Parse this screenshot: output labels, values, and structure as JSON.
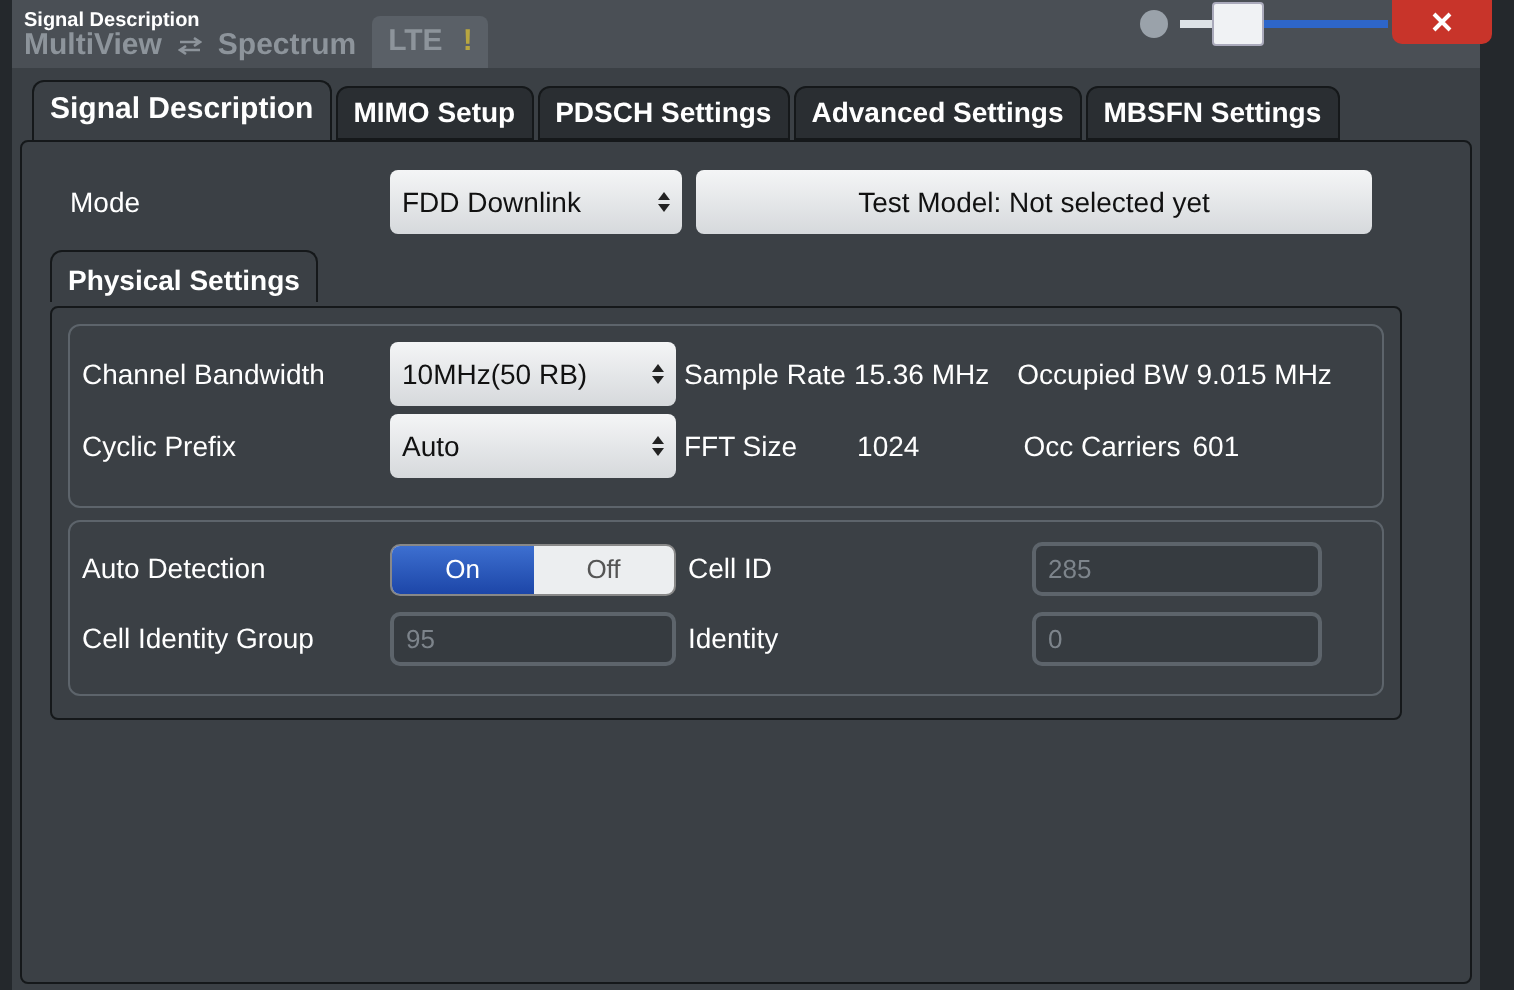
{
  "window": {
    "title": "Signal Description",
    "background_tabs": [
      {
        "label": "MultiView",
        "selected": false
      },
      {
        "label": "Spectrum",
        "selected": false
      },
      {
        "label": "LTE",
        "selected": true,
        "warning": "!"
      }
    ],
    "transparency": {
      "level": 0.2
    }
  },
  "tabs": [
    {
      "label": "Signal Description",
      "selected": true
    },
    {
      "label": "MIMO Setup",
      "selected": false
    },
    {
      "label": "PDSCH Settings",
      "selected": false
    },
    {
      "label": "Advanced Settings",
      "selected": false
    },
    {
      "label": "MBSFN Settings",
      "selected": false
    }
  ],
  "mode": {
    "label": "Mode",
    "value": "FDD Downlink",
    "test_model_button": "Test Model: Not selected yet"
  },
  "physical_settings": {
    "title": "Physical Settings",
    "channel_bandwidth": {
      "label": "Channel Bandwidth",
      "value": "10MHz(50 RB)"
    },
    "sample_rate": {
      "label": "Sample Rate",
      "value": "15.36 MHz"
    },
    "occupied_bw": {
      "label": "Occupied BW",
      "value": "9.015 MHz"
    },
    "cyclic_prefix": {
      "label": "Cyclic Prefix",
      "value": "Auto"
    },
    "fft_size": {
      "label": "FFT Size",
      "value": "1024"
    },
    "occ_carriers": {
      "label": "Occ Carriers",
      "value": "601"
    }
  },
  "detection": {
    "label": "Auto Detection",
    "options": [
      {
        "label": "On",
        "selected": true
      },
      {
        "label": "Off",
        "selected": false
      }
    ],
    "fields": [
      {
        "label": "Cell ID",
        "value": "285",
        "disabled": true
      },
      {
        "label": "Cell Identity Group",
        "value": "95",
        "disabled": true
      },
      {
        "label": "Identity",
        "value": "0",
        "disabled": true
      }
    ]
  }
}
